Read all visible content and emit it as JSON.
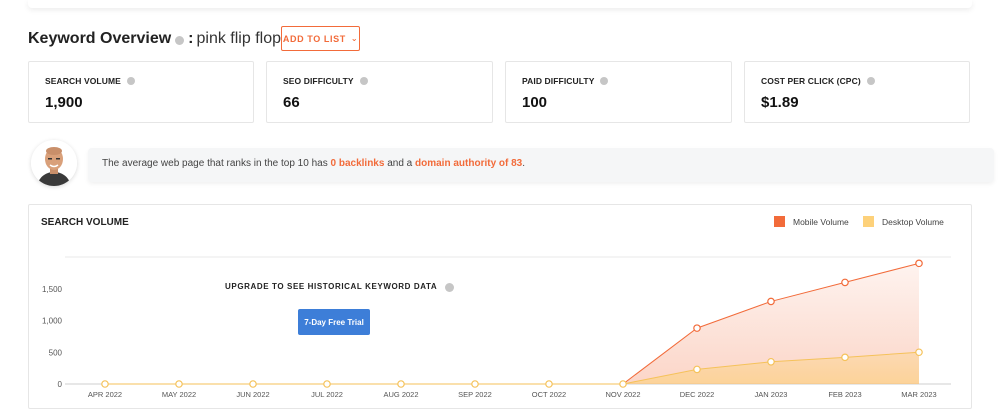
{
  "header": {
    "title": "Keyword Overview",
    "keyword": "pink flip flops",
    "add_to_list": "ADD TO LIST"
  },
  "metrics": [
    {
      "label": "SEARCH VOLUME",
      "value": "1,900"
    },
    {
      "label": "SEO DIFFICULTY",
      "value": "66"
    },
    {
      "label": "PAID DIFFICULTY",
      "value": "100"
    },
    {
      "label": "COST PER CLICK (CPC)",
      "value": "$1.89"
    }
  ],
  "banner": {
    "prefix": "The average web page that ranks in the top 10 has ",
    "backlinks": "0 backlinks",
    "middle": " and a ",
    "authority": "domain authority of 83",
    "suffix": "."
  },
  "chart_panel": {
    "title": "SEARCH VOLUME",
    "upgrade_text": "UPGRADE TO SEE HISTORICAL KEYWORD DATA",
    "trial_button": "7-Day Free Trial"
  },
  "colors": {
    "accent": "#f26b3a",
    "mobile": "#f26b3a",
    "desktop": "#fdd17a",
    "trial": "#3d7ed8"
  },
  "chart_data": {
    "type": "area",
    "categories": [
      "APR 2022",
      "MAY 2022",
      "JUN 2022",
      "JUL 2022",
      "AUG 2022",
      "SEP 2022",
      "OCT 2022",
      "NOV 2022",
      "DEC 2022",
      "JAN 2023",
      "FEB 2023",
      "MAR 2023"
    ],
    "yticks": [
      "0",
      "500",
      "1,000",
      "1,500"
    ],
    "ylim": [
      0,
      2000
    ],
    "series": [
      {
        "name": "Mobile Volume",
        "color": "#f26b3a",
        "values": [
          0,
          0,
          0,
          0,
          0,
          0,
          0,
          0,
          880,
          1300,
          1600,
          1900
        ]
      },
      {
        "name": "Desktop Volume",
        "color": "#fdd17a",
        "values": [
          0,
          0,
          0,
          0,
          0,
          0,
          0,
          0,
          230,
          350,
          420,
          500
        ]
      }
    ],
    "legend_position": "top-right",
    "grid": true
  }
}
